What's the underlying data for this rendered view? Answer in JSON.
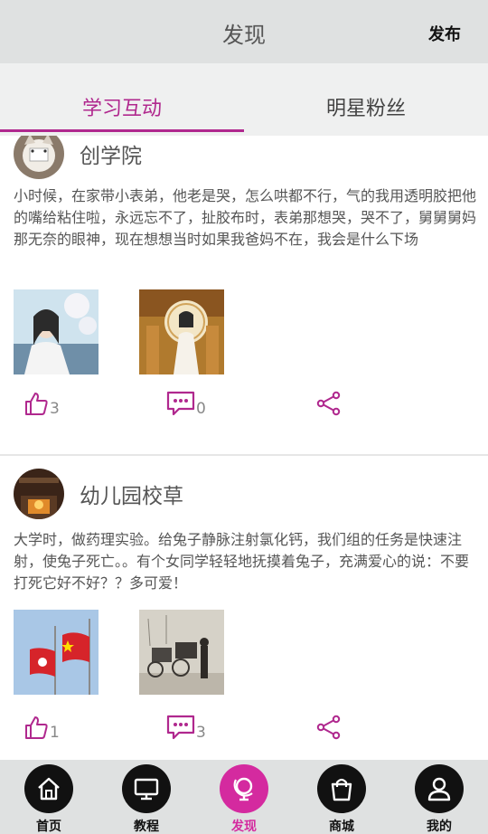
{
  "header": {
    "title": "发现",
    "publish_label": "发布"
  },
  "tabs": [
    {
      "label": "学习互动",
      "active": true
    },
    {
      "label": "明星粉丝",
      "active": false
    }
  ],
  "posts": [
    {
      "author": "创学院",
      "content": "小时候，在家带小表弟，他老是哭，怎么哄都不行，气的我用透明胶把他的嘴给粘住啦，永远忘不了，扯胶布时，表弟那想哭，哭不了，舅舅舅妈那无奈的眼神，现在想想当时如果我爸妈不在，我会是什么下场",
      "likes": "3",
      "comments": "0"
    },
    {
      "author": "幼儿园校草",
      "content": "大学时，做药理实验。给兔子静脉注射氯化钙，我们组的任务是快速注射，使兔子死亡。。有个女同学轻轻地抚摸着兔子，充满爱心的说：不要打死它好不好？？多可爱！",
      "likes": "1",
      "comments": "3"
    }
  ],
  "bottom_nav": [
    {
      "label": "首页",
      "icon": "home-icon",
      "active": false
    },
    {
      "label": "教程",
      "icon": "monitor-icon",
      "active": false
    },
    {
      "label": "发现",
      "icon": "globe-icon",
      "active": true
    },
    {
      "label": "商城",
      "icon": "shopping-bag-icon",
      "active": false
    },
    {
      "label": "我的",
      "icon": "user-icon",
      "active": false
    }
  ],
  "colors": {
    "accent": "#b0288e",
    "nav_active": "#d42a9f",
    "header_bg": "#dfe1e1",
    "tab_bg": "#eff0f0"
  }
}
